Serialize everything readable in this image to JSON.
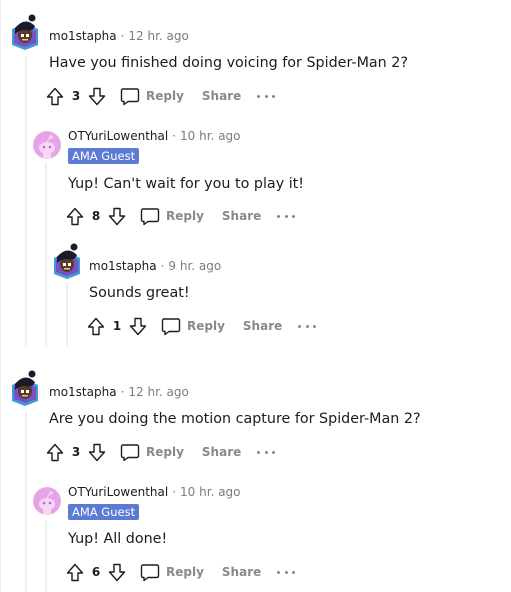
{
  "comments": [
    {
      "username": "mo1stapha",
      "time": "12 hr. ago",
      "body": "Have you finished doing voicing for Spider-Man 2?",
      "votes": "3",
      "reply_label": "Reply",
      "share_label": "Share"
    },
    {
      "username": "OTYuriLowenthal",
      "time": "10 hr. ago",
      "badge": "AMA Guest",
      "body": "Yup! Can't wait for you to play it!",
      "votes": "8",
      "reply_label": "Reply",
      "share_label": "Share"
    },
    {
      "username": "mo1stapha",
      "time": "9 hr. ago",
      "body": "Sounds great!",
      "votes": "1",
      "reply_label": "Reply",
      "share_label": "Share"
    },
    {
      "username": "mo1stapha",
      "time": "12 hr. ago",
      "body": "Are you doing the motion capture for Spider-Man 2?",
      "votes": "3",
      "reply_label": "Reply",
      "share_label": "Share"
    },
    {
      "username": "OTYuriLowenthal",
      "time": "10 hr. ago",
      "badge": "AMA Guest",
      "body": "Yup! All done!",
      "votes": "6",
      "reply_label": "Reply",
      "share_label": "Share"
    }
  ],
  "separator": "·",
  "colors": {
    "badge": "#5b7bd5",
    "muted": "#878a8c",
    "thread_line": "#edeff1",
    "guest_avatar": "#e7a3e8"
  },
  "icons": [
    "upvote-icon",
    "downvote-icon",
    "comment-bubble-icon",
    "more-options-icon",
    "user-avatar-icon",
    "snoo-avatar-icon"
  ]
}
